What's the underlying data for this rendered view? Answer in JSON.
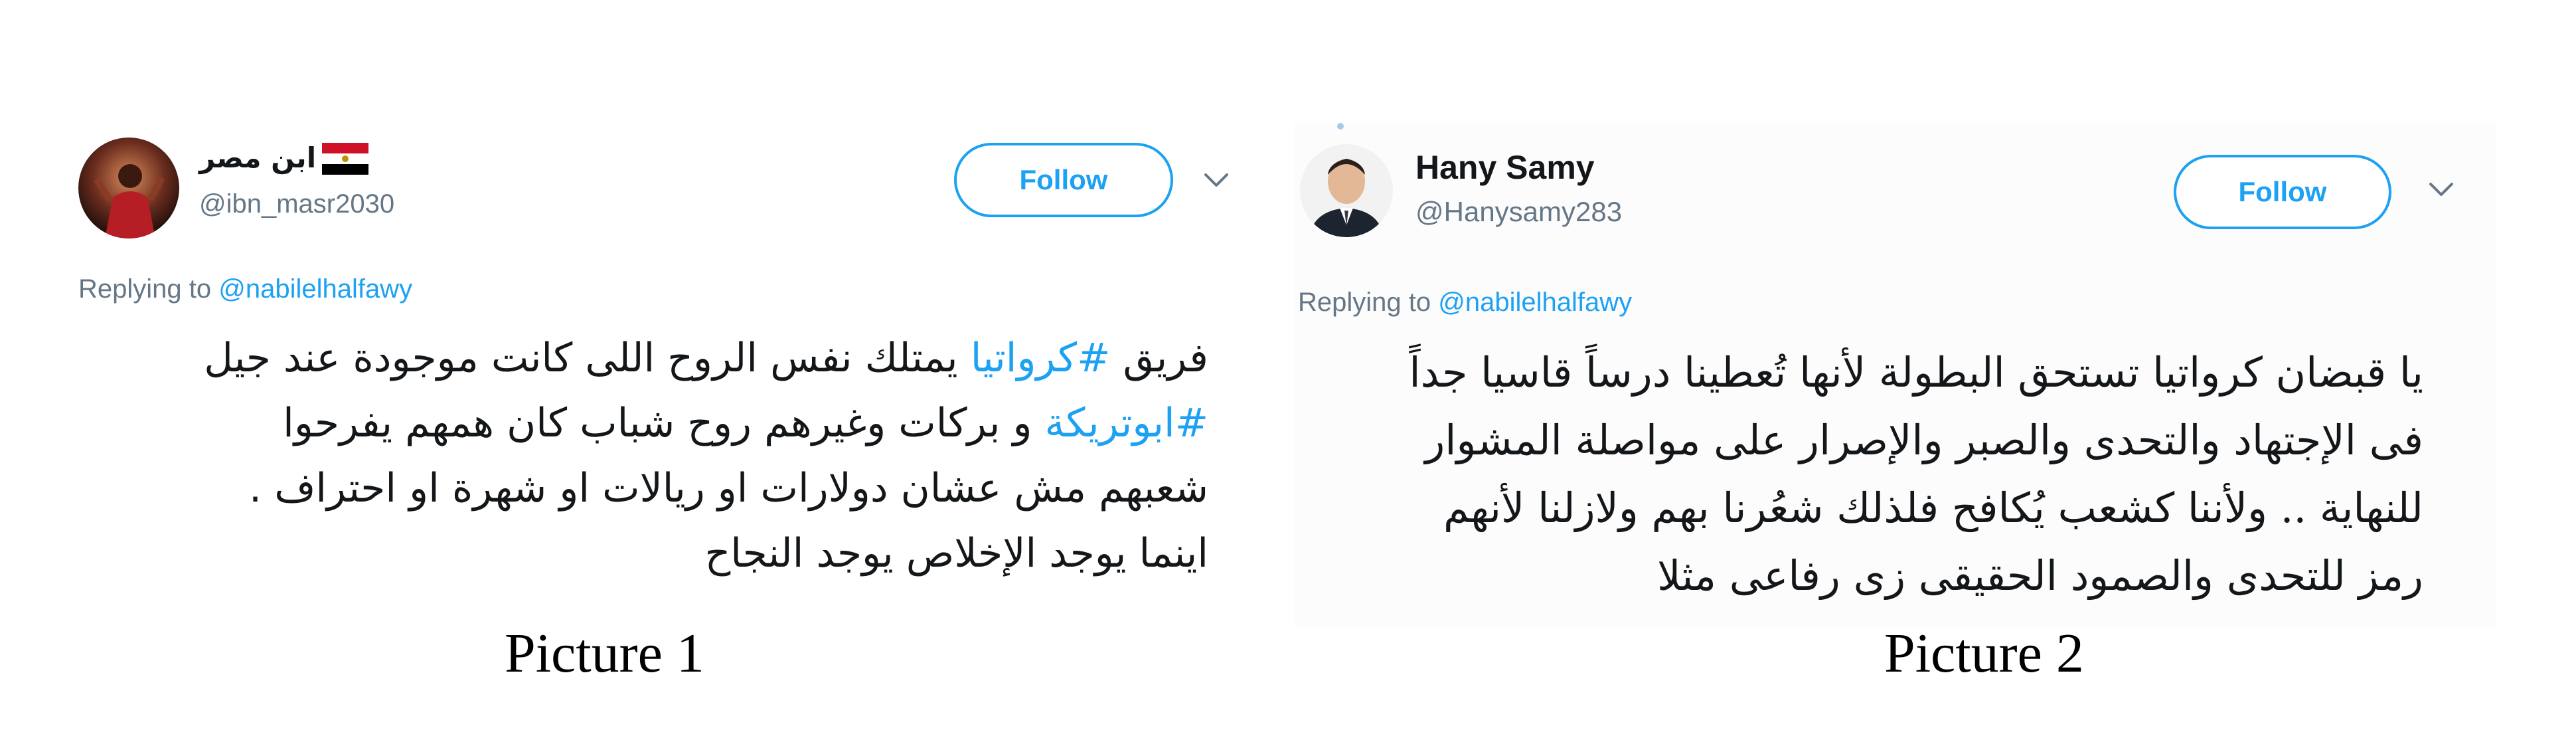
{
  "pictures": [
    {
      "caption": "Picture 1",
      "tweet": {
        "display_name": "ابن مصر",
        "handle": "@ibn_masr2030",
        "follow_label": "Follow",
        "replying_prefix": "Replying to",
        "replying_to": "@nabilelhalfawy",
        "body_lines": [
          {
            "pre": "فريق ",
            "tag": "#كرواتيا",
            "post": " يمتلك نفس الروح اللى كانت موجودة عند جيل"
          },
          {
            "pre": "",
            "tag": "#ابوتريكة",
            "post": " و بركات وغيرهم روح شباب كان همهم يفرحوا"
          },
          {
            "pre": "شعبهم مش عشان دولارات او ريالات او شهرة او احتراف .",
            "tag": "",
            "post": ""
          },
          {
            "pre": "اينما يوجد الإخلاص يوجد النجاح",
            "tag": "",
            "post": ""
          }
        ],
        "icons": {
          "flag": "egypt-flag-icon",
          "menu": "chevron-down-icon"
        }
      }
    },
    {
      "caption": "Picture 2",
      "tweet": {
        "display_name": "Hany Samy",
        "handle": "@Hanysamy283",
        "follow_label": "Follow",
        "replying_prefix": "Replying to",
        "replying_to": "@nabilelhalfawy",
        "body_lines": [
          "يا قبضان كرواتيا تستحق البطولة لأنها تُعطينا درساً قاسيا جداً",
          "فى الإجتهاد والتحدى والصبر والإصرار على مواصلة المشوار",
          "للنهاية .. ولأننا كشعب يُكافح فلذلك شعُرنا بهم ولازلنا لأنهم",
          "رمز للتحدى والصمود الحقيقى زى رفاعى مثلا"
        ],
        "icons": {
          "menu": "chevron-down-icon"
        }
      }
    }
  ],
  "colors": {
    "accent": "#1da1f2",
    "secondary_text": "#657786",
    "primary_text": "#14171a"
  }
}
